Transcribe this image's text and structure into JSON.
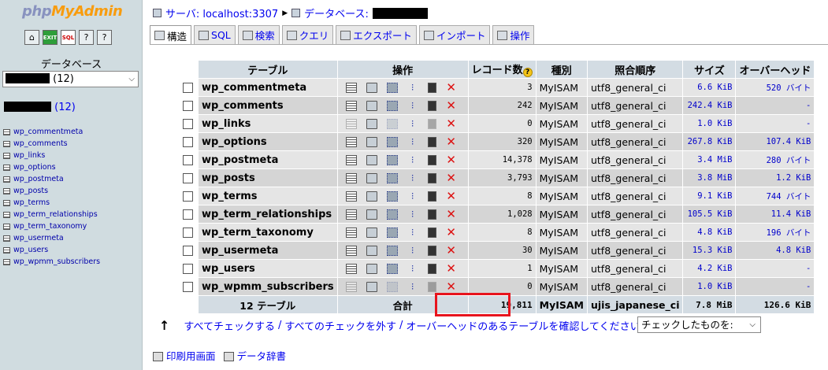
{
  "sidebar": {
    "logo": {
      "php": "php",
      "my": "My",
      "admin": "Admin"
    },
    "db_label": "データベース",
    "db_select_suffix": "(12)",
    "db_link_suffix": "(12)",
    "tables": [
      "wp_commentmeta",
      "wp_comments",
      "wp_links",
      "wp_options",
      "wp_postmeta",
      "wp_posts",
      "wp_terms",
      "wp_term_relationships",
      "wp_term_taxonomy",
      "wp_usermeta",
      "wp_users",
      "wp_wpmm_subscribers"
    ]
  },
  "breadcrumb": {
    "server": "サーバ: localhost:3307",
    "database": "データベース: "
  },
  "tabs": [
    "構造",
    "SQL",
    "検索",
    "クエリ",
    "エクスポート",
    "インポート",
    "操作"
  ],
  "table": {
    "headers": {
      "table": "テーブル",
      "ops": "操作",
      "records": "レコード数",
      "type": "種別",
      "collation": "照合順序",
      "size": "サイズ",
      "overhead": "オーバーヘッド"
    },
    "rows": [
      {
        "name": "wp_commentmeta",
        "records": "3",
        "type": "MyISAM",
        "collation": "utf8_general_ci",
        "size": "6.6 KiB",
        "overhead": "520 バイト",
        "empty": false
      },
      {
        "name": "wp_comments",
        "records": "242",
        "type": "MyISAM",
        "collation": "utf8_general_ci",
        "size": "242.4 KiB",
        "overhead": "-",
        "empty": false
      },
      {
        "name": "wp_links",
        "records": "0",
        "type": "MyISAM",
        "collation": "utf8_general_ci",
        "size": "1.0 KiB",
        "overhead": "-",
        "empty": true
      },
      {
        "name": "wp_options",
        "records": "320",
        "type": "MyISAM",
        "collation": "utf8_general_ci",
        "size": "267.8 KiB",
        "overhead": "107.4 KiB",
        "empty": false
      },
      {
        "name": "wp_postmeta",
        "records": "14,378",
        "type": "MyISAM",
        "collation": "utf8_general_ci",
        "size": "3.4 MiB",
        "overhead": "280 バイト",
        "empty": false
      },
      {
        "name": "wp_posts",
        "records": "3,793",
        "type": "MyISAM",
        "collation": "utf8_general_ci",
        "size": "3.8 MiB",
        "overhead": "1.2 KiB",
        "empty": false
      },
      {
        "name": "wp_terms",
        "records": "8",
        "type": "MyISAM",
        "collation": "utf8_general_ci",
        "size": "9.1 KiB",
        "overhead": "744 バイト",
        "empty": false
      },
      {
        "name": "wp_term_relationships",
        "records": "1,028",
        "type": "MyISAM",
        "collation": "utf8_general_ci",
        "size": "105.5 KiB",
        "overhead": "11.4 KiB",
        "empty": false
      },
      {
        "name": "wp_term_taxonomy",
        "records": "8",
        "type": "MyISAM",
        "collation": "utf8_general_ci",
        "size": "4.8 KiB",
        "overhead": "196 バイト",
        "empty": false
      },
      {
        "name": "wp_usermeta",
        "records": "30",
        "type": "MyISAM",
        "collation": "utf8_general_ci",
        "size": "15.3 KiB",
        "overhead": "4.8 KiB",
        "empty": false
      },
      {
        "name": "wp_users",
        "records": "1",
        "type": "MyISAM",
        "collation": "utf8_general_ci",
        "size": "4.2 KiB",
        "overhead": "-",
        "empty": false
      },
      {
        "name": "wp_wpmm_subscribers",
        "records": "0",
        "type": "MyISAM",
        "collation": "utf8_general_ci",
        "size": "1.0 KiB",
        "overhead": "-",
        "empty": true
      }
    ],
    "footer": {
      "count": "12 テーブル",
      "sum_label": "合計",
      "records": "19,811",
      "type": "MyISAM",
      "collation": "ujis_japanese_ci",
      "size": "7.8 MiB",
      "overhead": "126.6 KiB"
    }
  },
  "check_links": {
    "check_all": "すべてチェックする",
    "uncheck_all": "すべてのチェックを外す",
    "check_overhead": "オーバーヘッドのあるテーブルを確認してください",
    "separator": "/"
  },
  "with_selected": "チェックしたものを:",
  "bottom_links": {
    "print": "印刷用画面",
    "dictionary": "データ辞書"
  }
}
